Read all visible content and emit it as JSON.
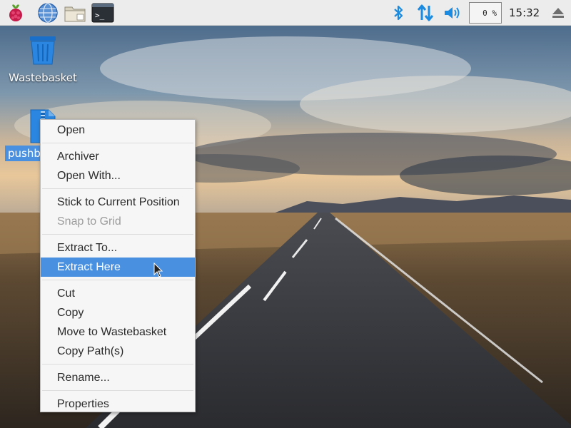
{
  "panel": {
    "launchers": [
      {
        "icon": "raspberry-menu-icon"
      },
      {
        "icon": "web-browser-icon"
      },
      {
        "icon": "file-manager-icon"
      },
      {
        "icon": "terminal-icon"
      }
    ],
    "tray": {
      "bluetooth_icon": "bluetooth-icon",
      "network_icon": "network-updown-icon",
      "volume_icon": "volume-icon",
      "cpu_usage": "0 %",
      "clock": "15:32",
      "eject_icon": "eject-icon"
    }
  },
  "desktop": {
    "wastebasket_label": "Wastebasket",
    "selected_file_label": "pushbutton.zip",
    "selected_file_visible_label": "pushb"
  },
  "context_menu": {
    "groups": [
      [
        {
          "label": "Open"
        }
      ],
      [
        {
          "label": "Archiver"
        },
        {
          "label": "Open With..."
        }
      ],
      [
        {
          "label": "Stick to Current Position"
        },
        {
          "label": "Snap to Grid",
          "disabled": true
        }
      ],
      [
        {
          "label": "Extract To..."
        },
        {
          "label": "Extract Here",
          "highlighted": true
        }
      ],
      [
        {
          "label": "Cut"
        },
        {
          "label": "Copy"
        },
        {
          "label": "Move to Wastebasket"
        },
        {
          "label": "Copy Path(s)"
        }
      ],
      [
        {
          "label": "Rename..."
        }
      ],
      [
        {
          "label": "Properties"
        }
      ]
    ]
  },
  "colors": {
    "highlight": "#4a90e0",
    "panel_bg": "#ececec",
    "tray_icon": "#1a8be0"
  }
}
